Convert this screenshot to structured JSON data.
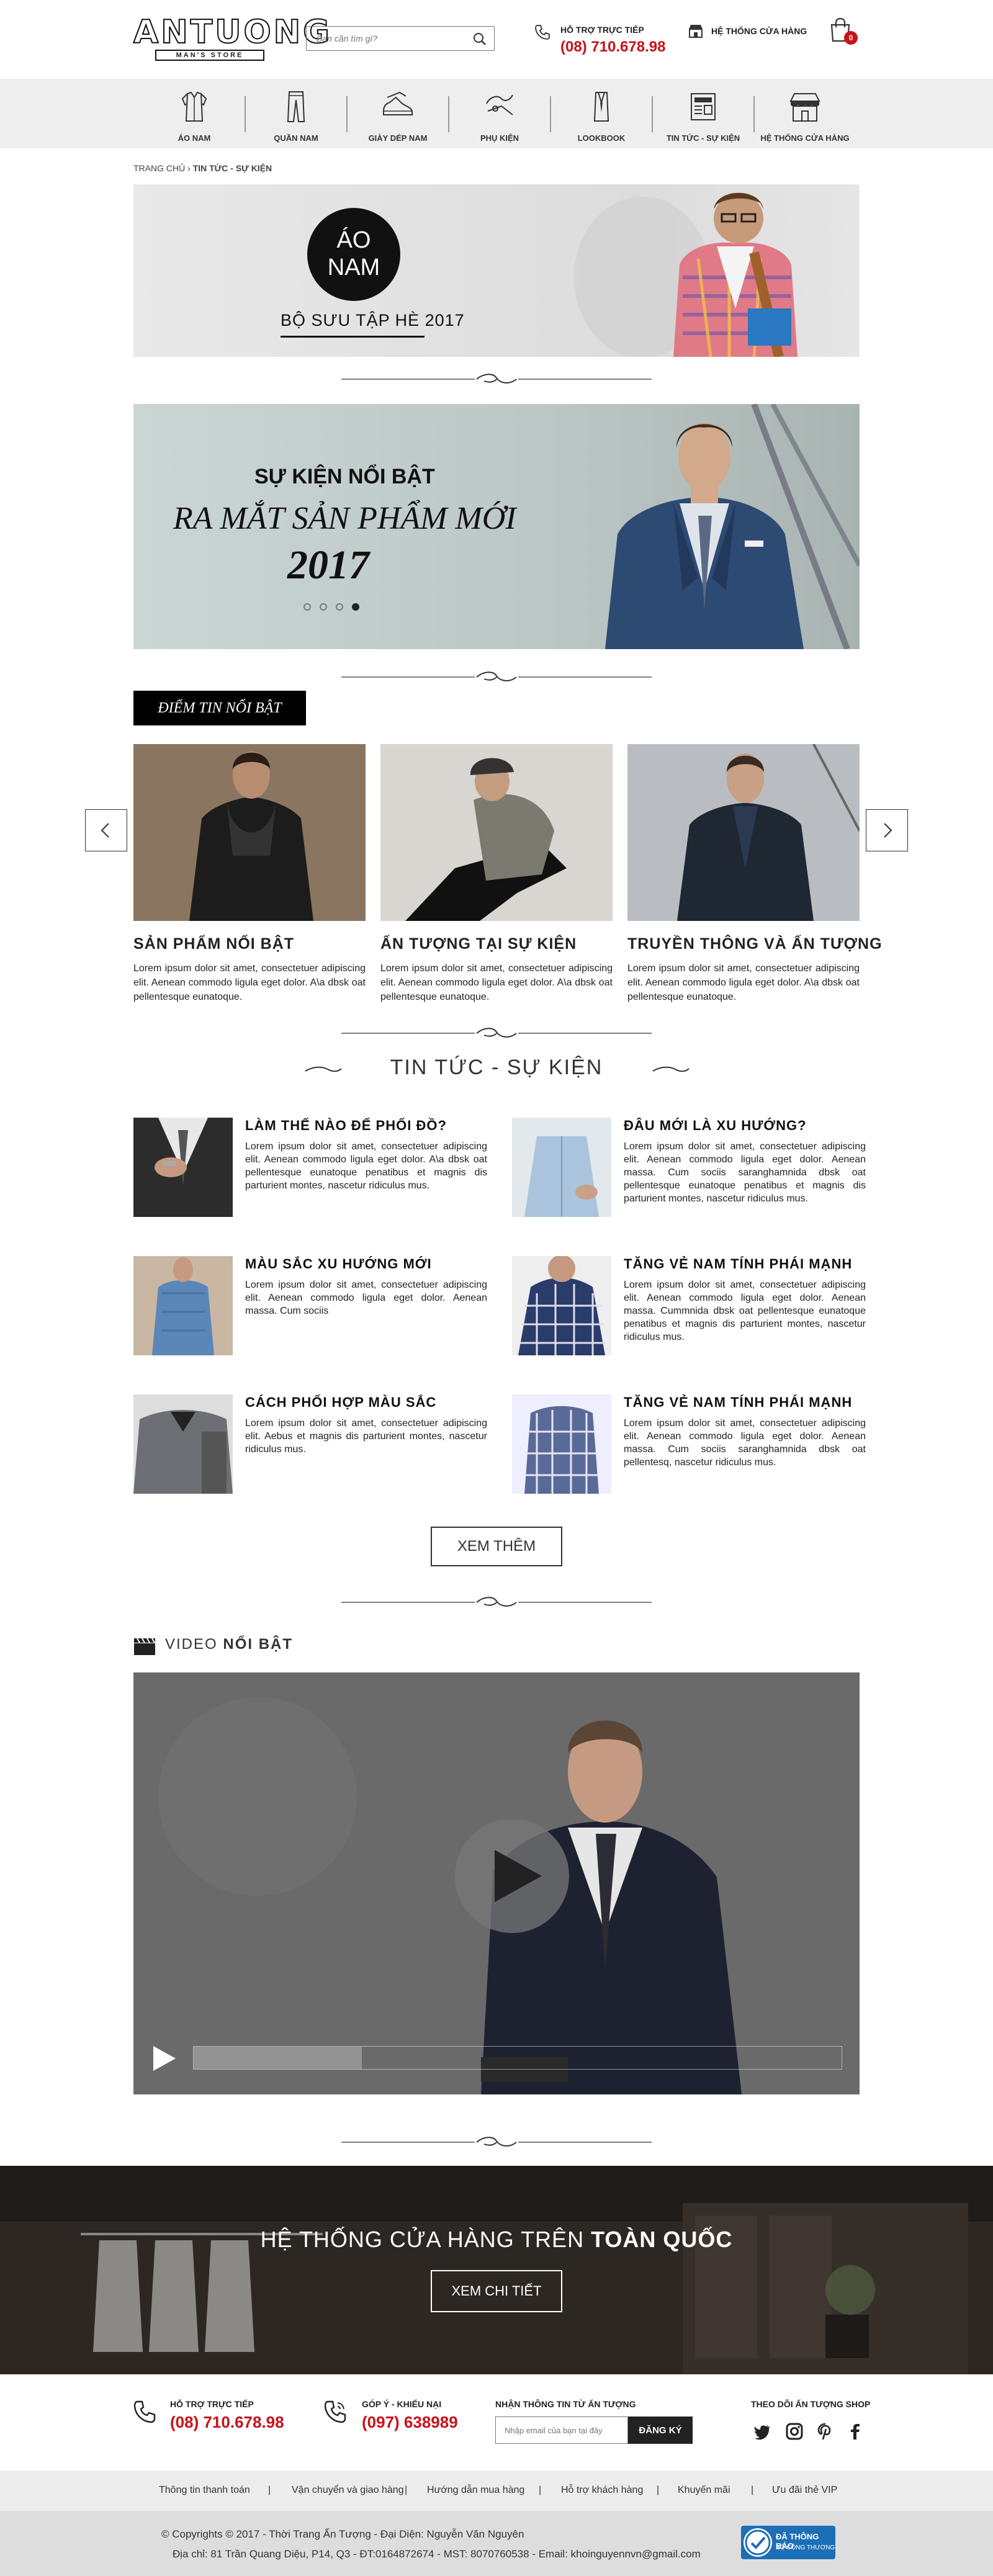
{
  "header": {
    "logo": "ANTUONG",
    "logo_sub": "MAN'S STORE",
    "search_placeholder": "Bạn cần tìm gì?",
    "hotline_label": "HỖ TRỢ TRỰC TIẾP",
    "hotline_number": "(08) 710.678.98",
    "store_system": "HỆ THỐNG CỬA HÀNG",
    "cart_count": "0"
  },
  "nav": [
    {
      "label": "ÁO NAM",
      "icon": "shirt-icon"
    },
    {
      "label": "QUẦN NAM",
      "icon": "pants-icon"
    },
    {
      "label": "GIÀY DÉP NAM",
      "icon": "shoe-icon"
    },
    {
      "label": "PHỤ KIỆN",
      "icon": "tie-icon"
    },
    {
      "label": "LOOKBOOK",
      "icon": "suit-icon"
    },
    {
      "label": "TIN TỨC - SỰ KIỆN",
      "icon": "newspaper-icon"
    },
    {
      "label": "HỆ THỐNG CỬA HÀNG",
      "icon": "storefront-icon"
    }
  ],
  "breadcrumb": {
    "home": "TRANG CHỦ",
    "sep": " › ",
    "current": "TIN TỨC - SỰ KIỆN"
  },
  "banner1": {
    "circle_line1": "ÁO",
    "circle_line2": "NAM",
    "caption": "BỘ SƯU TẬP HÈ 2017"
  },
  "banner2": {
    "event": "SỰ KIỆN NỔI BẬT",
    "launch": "RA MẮT SẢN PHẨM MỚI",
    "year": "2017",
    "slides": 4,
    "active_slide": 4
  },
  "featured": {
    "tag": "ĐIỂM TIN NỔI BẬT",
    "cards": [
      {
        "title": "SẢN PHẨM NỔI BẬT",
        "desc": "Lorem ipsum dolor sit amet, consectetuer adipiscing elit. Aenean commodo ligula eget dolor. A\\a dbsk oat pellentesque eunatoque."
      },
      {
        "title": "ẤN TƯỢNG TẠI SỰ KIỆN",
        "desc": "Lorem ipsum dolor sit amet, consectetuer adipiscing elit. Aenean commodo ligula eget dolor. A\\a dbsk oat pellentesque eunatoque."
      },
      {
        "title": "TRUYỀN THÔNG VÀ ẤN TƯỢNG",
        "desc": "Lorem ipsum dolor sit amet, consectetuer adipiscing elit. Aenean commodo ligula eget dolor. A\\a dbsk oat pellentesque eunatoque."
      }
    ]
  },
  "news_section": {
    "title": "TIN TỨC - SỰ KIỆN",
    "items": [
      {
        "title": "LÀM THẾ NÀO ĐỂ PHỐI ĐỒ?",
        "desc": "Lorem ipsum dolor sit amet, consectetuer adipiscing elit. Aenean commodo ligula eget dolor. A\\a dbsk oat pellentesque eunatoque penatibus et magnis dis parturient montes, nascetur ridiculus mus."
      },
      {
        "title": "ĐÂU MỚI LÀ XU HƯỚNG?",
        "desc": "Lorem ipsum dolor sit amet, consectetuer adipiscing elit. Aenean commodo ligula eget dolor. Aenean massa. Cum sociis saranghamnida dbsk oat pellentesque eunatoque penatibus et magnis dis parturient montes, nascetur ridiculus mus."
      },
      {
        "title": "MÀU SẮC XU HƯỚNG MỚI",
        "desc": "Lorem ipsum dolor sit amet, consectetuer adipiscing elit. Aenean commodo ligula eget dolor. Aenean massa. Cum sociis"
      },
      {
        "title": "TĂNG VẺ NAM TÍNH PHÁI MẠNH",
        "desc": "Lorem ipsum dolor sit amet, consectetuer adipiscing elit. Aenean commodo ligula eget dolor. Aenean massa. Cummnida dbsk oat pellentesque eunatoque penatibus et magnis dis parturient montes, nascetur ridiculus mus."
      },
      {
        "title": "CÁCH PHỐI HỢP MÀU SẮC",
        "desc": "Lorem ipsum dolor sit amet, consectetuer adipiscing elit. Aebus et magnis dis parturient montes, nascetur ridiculus mus."
      },
      {
        "title": "TĂNG VẺ NAM TÍNH PHÁI MẠNH",
        "desc": "Lorem ipsum dolor sit amet, consectetuer adipiscing elit. Aenean commodo ligula eget dolor. Aenean massa. Cum sociis saranghamnida dbsk oat pellentesq, nascetur ridiculus mus."
      }
    ],
    "more_label": "XEM THÊM"
  },
  "video": {
    "label_light": "VIDEO ",
    "label_bold": "NỔI BẬT",
    "progress": 0.26
  },
  "stores": {
    "title_light": "HỆ THỐNG CỬA HÀNG TRÊN ",
    "title_bold": "TOÀN QUỐC",
    "button": "XEM CHI TIẾT"
  },
  "footer": {
    "support_label": "HỖ TRỢ TRỰC TIẾP",
    "support_number": "(08) 710.678.98",
    "feedback_label": "GÓP Ý - KHIẾU NẠI",
    "feedback_number": "(097) 638989",
    "newsletter_label": "NHẬN THÔNG TIN TỪ ẤN TƯỢNG",
    "newsletter_placeholder": "Nhập email của bạn tại đây",
    "newsletter_button": "ĐĂNG KÝ",
    "follow_label": "THEO DÕI ẤN TƯỢNG SHOP",
    "links": [
      "Thông tin thanh toán",
      "Vận chuyển và giao hàng",
      "Hướng dẫn mua hàng",
      "Hỗ trợ khách hàng",
      "Khuyến mãi",
      "Ưu đãi thẻ VIP"
    ],
    "copyright": "© Copyrights © 2017 - Thời Trang Ấn Tượng - Đại Diện: Nguyễn Văn Nguyên",
    "address": "Địa chỉ: 81 Trần Quang Diệu, P14, Q3 - ĐT:0164872674 - MST: 8070760538 - Email: khoinguyennvn@gmail.com",
    "badge_line1": "ĐÃ THÔNG BÁO",
    "badge_line2": "BỘ CÔNG THƯƠNG"
  },
  "colors": {
    "accent": "#c9121a",
    "nav_bg": "#eeeeee",
    "footer_bg": "#dddddd"
  }
}
